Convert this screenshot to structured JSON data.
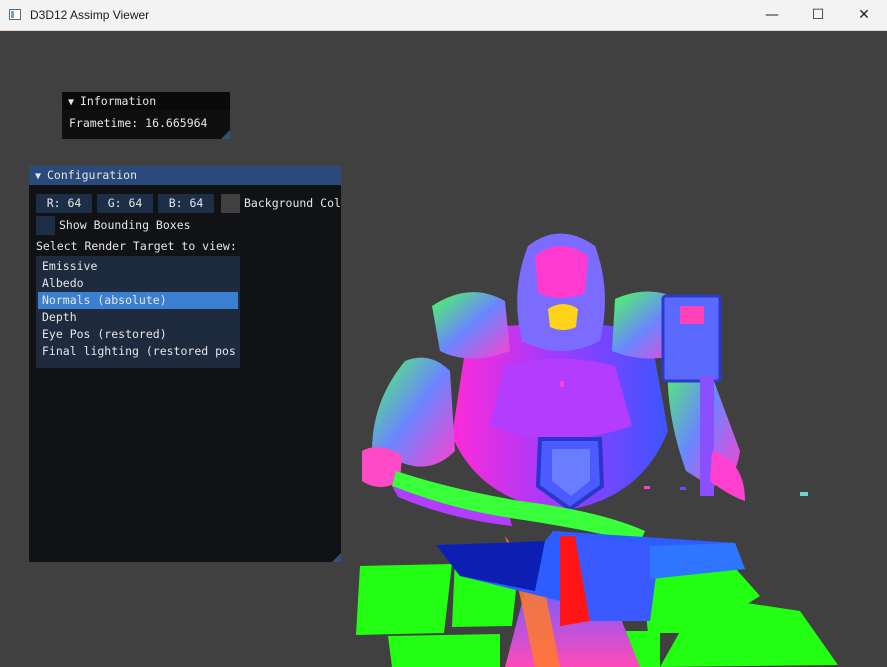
{
  "window": {
    "title": "D3D12 Assimp Viewer",
    "min_glyph": "—",
    "max_glyph": "☐",
    "close_glyph": "✕"
  },
  "info_window": {
    "title": "Information",
    "collapse_glyph": "▼",
    "frametime": "Frametime: 16.665964"
  },
  "config_window": {
    "title": "Configuration",
    "collapse_glyph": "▼",
    "background": {
      "r": "R: 64",
      "g": "G: 64",
      "b": "B: 64",
      "label": "Background Color"
    },
    "show_bounding_boxes": "Show Bounding Boxes",
    "select_label": "Select Render Target to view:",
    "render_targets": [
      "Emissive",
      "Albedo",
      "Normals (absolute)",
      "Depth",
      "Eye Pos (restored)",
      "Final lighting (restored pos)"
    ],
    "selected_index": 2
  },
  "colors": {
    "viewport_bg": "#404040",
    "imgui_header_active": "#294a7a",
    "selection": "#3a7fd0"
  },
  "scene": {
    "content": "normals render of armored warrior with hammer and sword over an anvil"
  }
}
